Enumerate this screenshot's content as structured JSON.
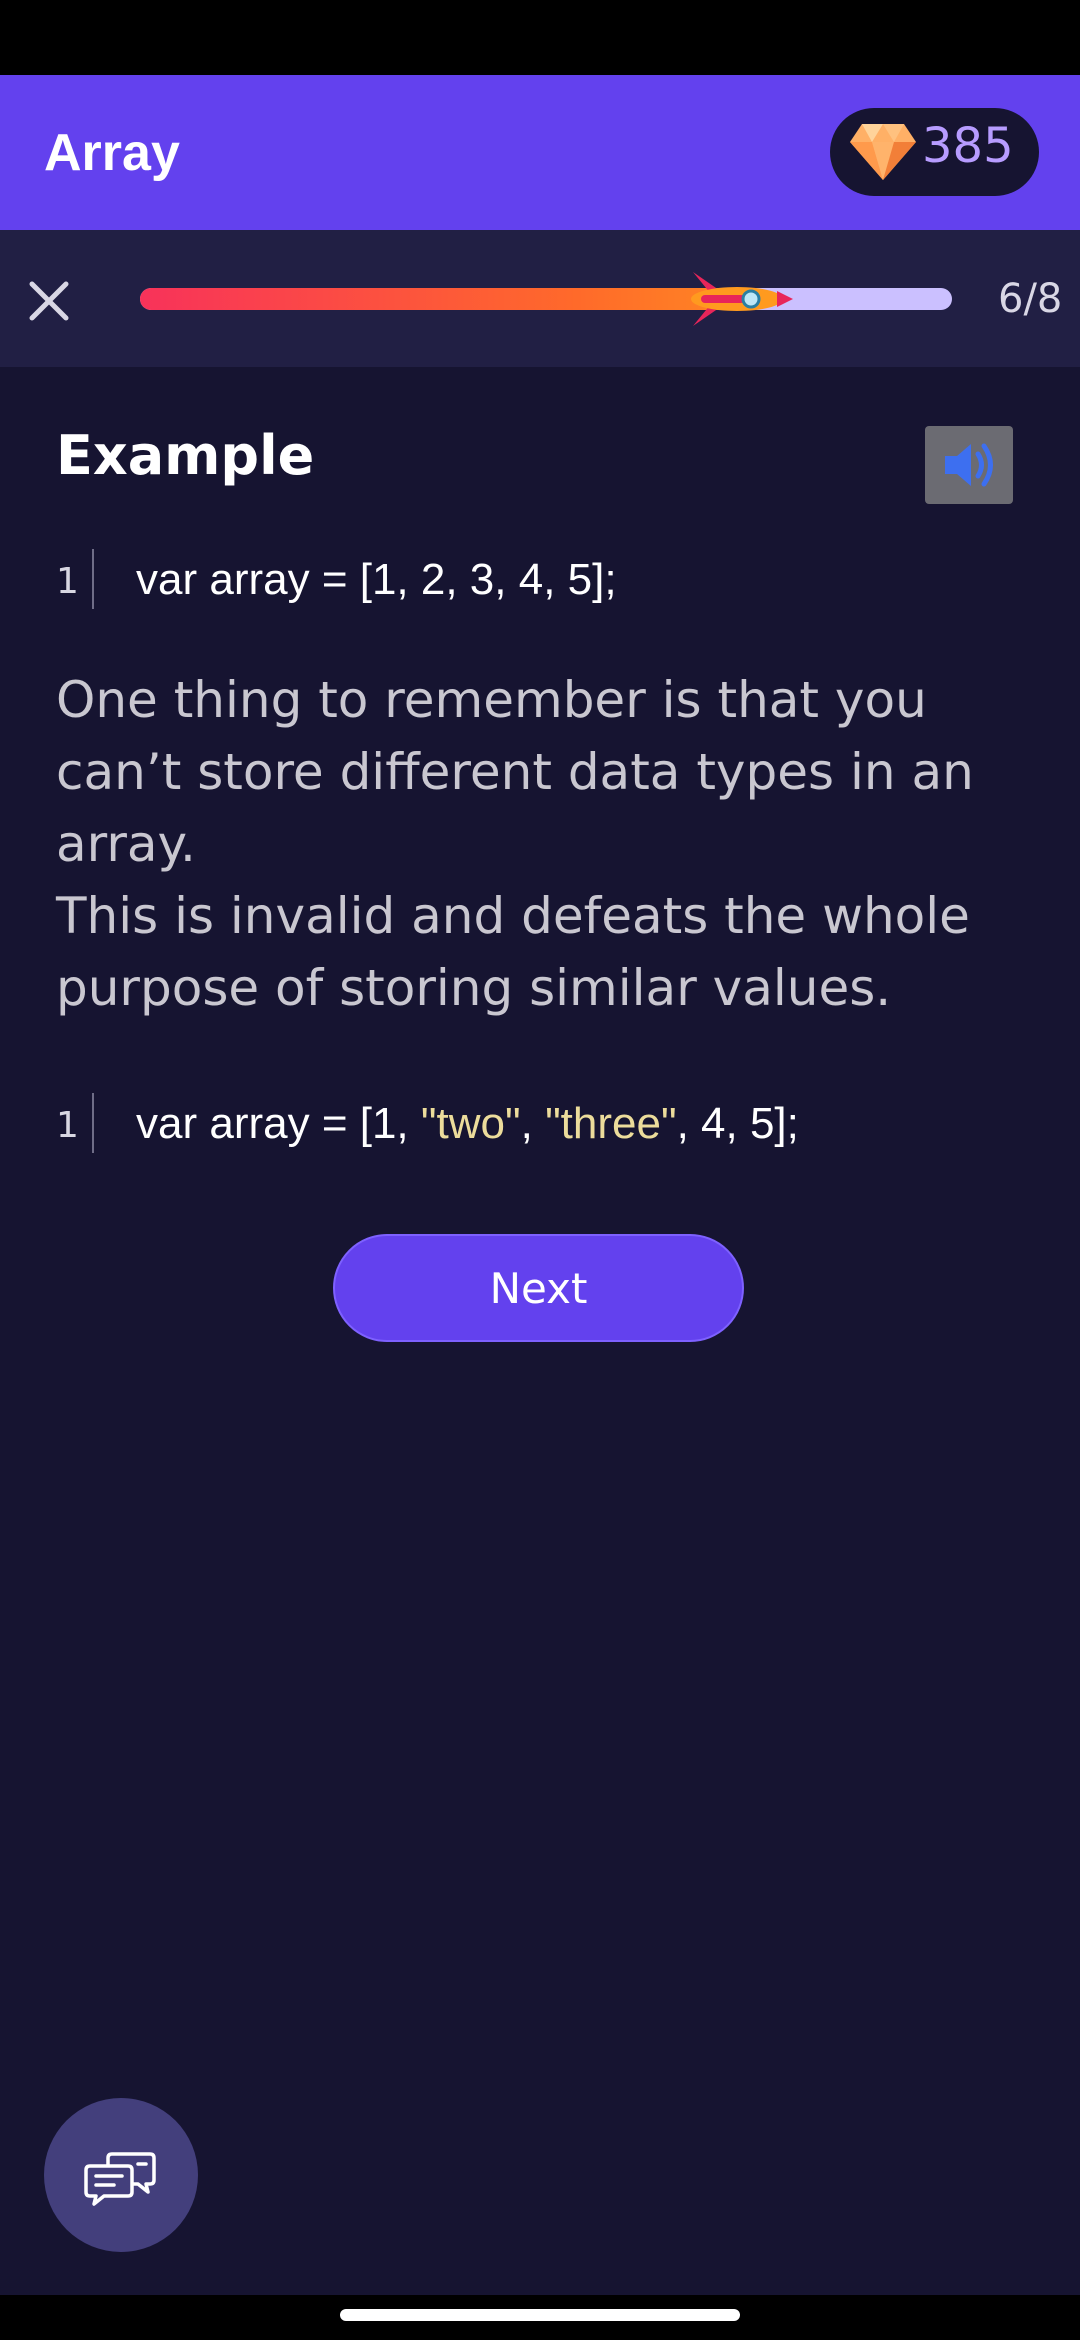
{
  "app_bar": {
    "title": "Array",
    "gems": "385"
  },
  "progress": {
    "counter": "6/8",
    "fraction": 0.77
  },
  "lesson": {
    "section_title": "Example",
    "code_1": {
      "line_number": "1",
      "prefix": "var array = [1, 2, 3, 4, 5];"
    },
    "paragraph_1": "One thing to remember is that you can’t store different data types in an array.",
    "paragraph_2": "This is invalid and defeats the whole purpose of storing similar values.",
    "code_2": {
      "line_number": "1",
      "part_1": "var array = [1, ",
      "string_1": "\"two\"",
      "part_2": ", ",
      "string_2": "\"three\"",
      "part_3": ", 4, 5];"
    },
    "next_label": "Next"
  },
  "colors": {
    "app_bar": "#6341ee",
    "background": "#161431",
    "string_literal": "#ecdc9b",
    "gem_count": "#b79cff"
  },
  "icons": {
    "close": "close-icon",
    "gem": "gem-icon",
    "rocket": "rocket-icon",
    "audio": "speaker-icon",
    "chat": "chat-bubbles-icon"
  }
}
